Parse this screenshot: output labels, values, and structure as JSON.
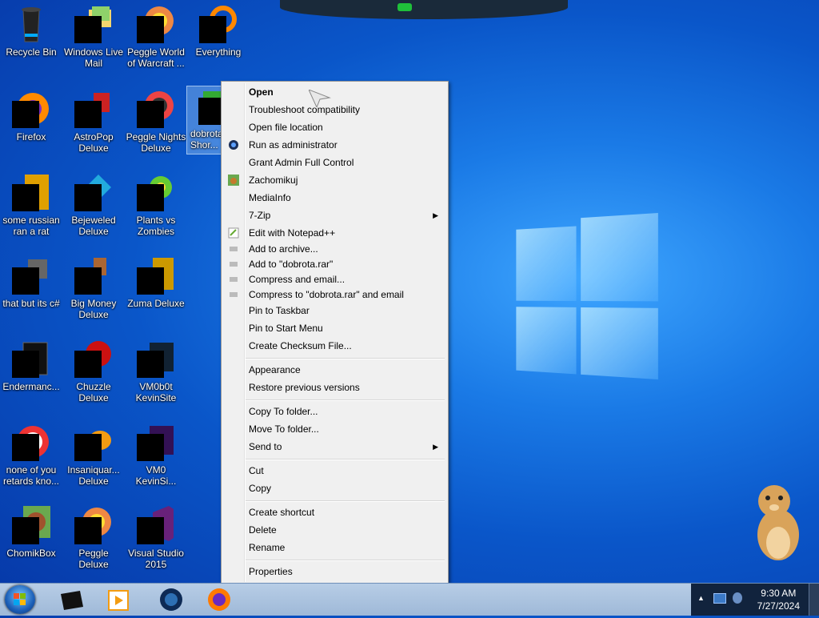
{
  "desktop": {
    "icons": [
      {
        "label": "Recycle Bin",
        "icon": "recycle-bin-icon"
      },
      {
        "label": "Windows Live Mail",
        "icon": "mail-icon"
      },
      {
        "label": "Peggle World of Warcraft ...",
        "icon": "peggle-icon"
      },
      {
        "label": "Everything",
        "icon": "search-icon"
      },
      {
        "label": "Firefox",
        "icon": "firefox-icon"
      },
      {
        "label": "AstroPop Deluxe",
        "icon": "game-icon"
      },
      {
        "label": "Peggle Nights Deluxe",
        "icon": "peggle-icon"
      },
      {
        "label": "dobrota Shor...",
        "icon": "shortcut-icon"
      },
      {
        "label": "some russian ran a rat",
        "icon": "app-icon"
      },
      {
        "label": "Bejeweled Deluxe",
        "icon": "gem-icon"
      },
      {
        "label": "Plants vs Zombies",
        "icon": "plant-icon"
      },
      {
        "label": "that but its c#",
        "icon": "app-icon"
      },
      {
        "label": "Big Money Deluxe",
        "icon": "game-icon"
      },
      {
        "label": "Zuma Deluxe",
        "icon": "game-icon"
      },
      {
        "label": "Endermanc...",
        "icon": "app-icon"
      },
      {
        "label": "Chuzzle Deluxe",
        "icon": "game-icon"
      },
      {
        "label": "VM0b0t KevinSite",
        "icon": "app-icon"
      },
      {
        "label": "none of you retards kno...",
        "icon": "app-icon"
      },
      {
        "label": "Insaniquar... Deluxe",
        "icon": "fish-icon"
      },
      {
        "label": "VM0 KevinSi...",
        "icon": "app-icon"
      },
      {
        "label": "ChomikBox",
        "icon": "hamster-icon"
      },
      {
        "label": "Peggle Deluxe",
        "icon": "peggle-icon"
      },
      {
        "label": "Visual Studio 2015",
        "icon": "visual-studio-icon"
      }
    ]
  },
  "context_menu": {
    "items": [
      "Open",
      "Troubleshoot compatibility",
      "Open file location",
      "Run as administrator",
      "Grant Admin Full Control",
      "Zachomikuj",
      "MediaInfo",
      "7-Zip",
      "Edit with Notepad++",
      "Add to archive...",
      "Add to \"dobrota.rar\"",
      "Compress and email...",
      "Compress to \"dobrota.rar\" and email",
      "Pin to Taskbar",
      "Pin to Start Menu",
      "Create Checksum File...",
      "Appearance",
      "Restore previous versions",
      "Copy To folder...",
      "Move To folder...",
      "Send to",
      "Cut",
      "Copy",
      "Create shortcut",
      "Delete",
      "Rename",
      "Properties"
    ]
  },
  "taskbar": {
    "pinned": [
      "terminal-icon",
      "media-player-icon",
      "firefox-icon"
    ],
    "clock_time": "9:30 AM",
    "clock_date": "7/27/2024"
  }
}
